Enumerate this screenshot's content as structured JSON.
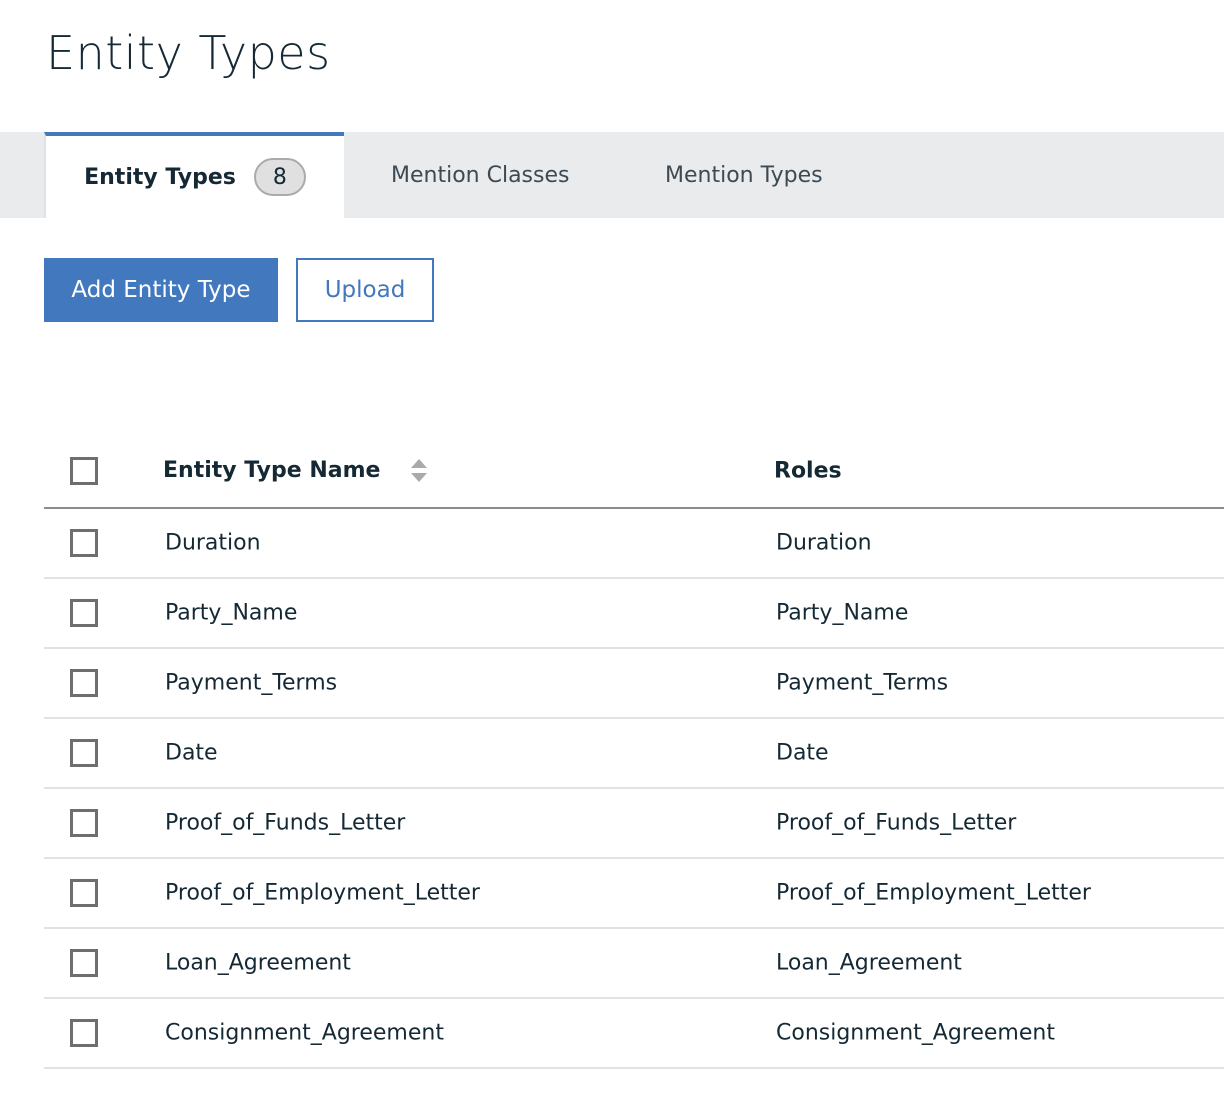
{
  "page_title": "Entity Types",
  "tabs": [
    {
      "label": "Entity Types",
      "count": "8",
      "active": true
    },
    {
      "label": "Mention Classes"
    },
    {
      "label": "Mention Types"
    }
  ],
  "toolbar": {
    "add_label": "Add Entity Type",
    "upload_label": "Upload"
  },
  "table": {
    "headers": [
      "Entity Type Name",
      "Roles"
    ],
    "sort_icon": "sort-arrows-icon",
    "rows": [
      [
        "Duration",
        "Duration"
      ],
      [
        "Party_Name",
        "Party_Name"
      ],
      [
        "Payment_Terms",
        "Payment_Terms"
      ],
      [
        "Date",
        "Date"
      ],
      [
        "Proof_of_Funds_Letter",
        "Proof_of_Funds_Letter"
      ],
      [
        "Proof_of_Employment_Letter",
        "Proof_of_Employment_Letter"
      ],
      [
        "Loan_Agreement",
        "Loan_Agreement"
      ],
      [
        "Consignment_Agreement",
        "Consignment_Agreement"
      ]
    ]
  },
  "colors": {
    "accent": "#4178be",
    "text": "#152935",
    "tabbar": "#e9ebec"
  }
}
